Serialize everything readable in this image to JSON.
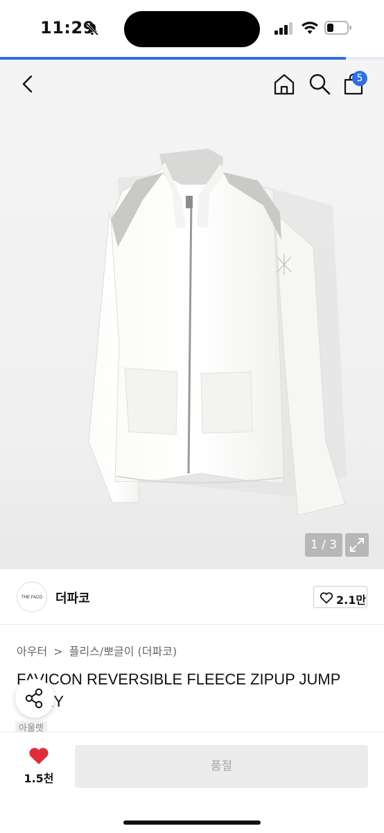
{
  "status_bar": {
    "time": "11:29",
    "icons": [
      "bell-muted-icon",
      "signal-icon",
      "wifi-icon",
      "battery-icon"
    ]
  },
  "loading": {
    "progress": 0.9
  },
  "header": {
    "icons": [
      "back-icon",
      "home-icon",
      "search-icon",
      "shopping-bag-icon"
    ],
    "cart_count": "5"
  },
  "product_image": {
    "counter": "1 / 3",
    "icons": [
      "expand-icon"
    ]
  },
  "brand": {
    "logo_text": "THE FACO",
    "name": "더파코",
    "like_count": "2.1만"
  },
  "breadcrumb": {
    "category": "아우터",
    "separator": ">",
    "subcategory": "플리스/뽀글이 (더파코)"
  },
  "product": {
    "title": "FAVICON REVERSIBLE FLEECE ZIPUP JUMP IVORY",
    "tag": "아울렛"
  },
  "bottom_bar": {
    "wish_count": "1.5천",
    "buy_label": "품절"
  },
  "colors": {
    "accent": "#2f6fe0",
    "heart": "#e02d3c",
    "soldout_bg": "#ececec"
  }
}
